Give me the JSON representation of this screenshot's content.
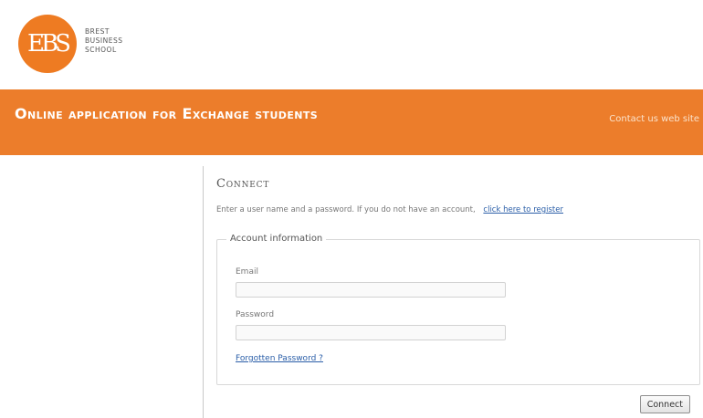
{
  "logo": {
    "monogram": "EBS",
    "lines": [
      "BREST",
      "BUSINESS",
      "SCHOOL"
    ]
  },
  "banner": {
    "title": "Online application for Exchange students",
    "link_label": "Contact us web site"
  },
  "connect": {
    "heading": "Connect",
    "intro_text": "Enter a user name and a password. If you do not have an account,",
    "register_link": "click here to register",
    "account_legend": "Account information",
    "email_label": "Email",
    "email_value": "",
    "password_label": "Password",
    "password_value": "",
    "forgotten_link": "Forgotten Password ?",
    "button_label": "Connect"
  },
  "colors": {
    "brand_orange": "#ec7d2b",
    "link_blue": "#2a5ea8"
  }
}
